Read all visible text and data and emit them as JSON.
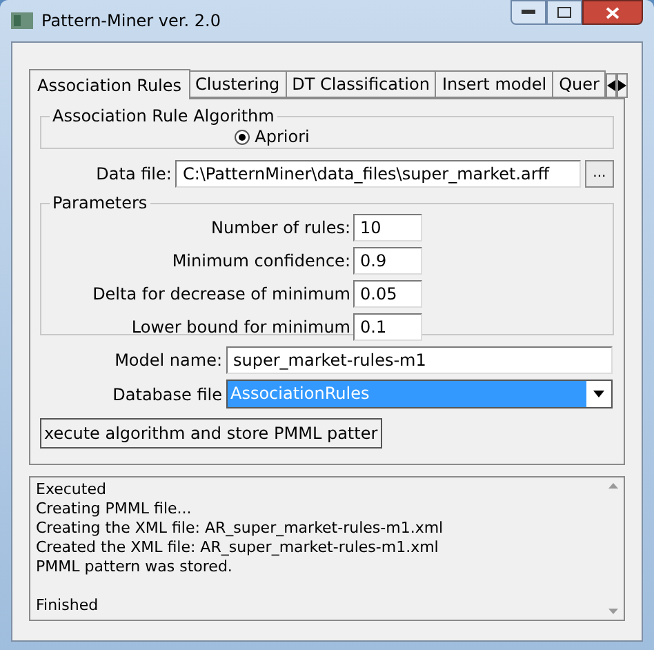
{
  "window": {
    "title": "Pattern-Miner ver. 2.0"
  },
  "tabs": [
    {
      "label": "Association Rules",
      "selected": true
    },
    {
      "label": "Clustering",
      "selected": false
    },
    {
      "label": "DT Classification",
      "selected": false
    },
    {
      "label": "Insert model",
      "selected": false
    },
    {
      "label": "Quer",
      "selected": false
    }
  ],
  "algorithm_group": {
    "title": "Association Rule Algorithm",
    "options": [
      {
        "label": "Apriori",
        "selected": true
      }
    ]
  },
  "data_file": {
    "label": "Data file:",
    "value": "C:\\PatternMiner\\data_files\\super_market.arff",
    "browse": "..."
  },
  "parameters": {
    "title": "Parameters",
    "fields": [
      {
        "label": "Number of rules:",
        "value": "10"
      },
      {
        "label": "Minimum confidence:",
        "value": "0.9"
      },
      {
        "label": "Delta for decrease of minimum",
        "value": "0.05"
      },
      {
        "label": "Lower bound for minimum",
        "value": "0.1"
      }
    ]
  },
  "model_name": {
    "label": "Model name:",
    "value": "super_market-rules-m1"
  },
  "database_file": {
    "label": "Database file",
    "value": "AssociationRules"
  },
  "execute_button": "xecute algorithm and store PMML patter",
  "log": [
    [
      "Executed",
      "Creating PMML file...",
      "Creating the XML file: AR_super_market-rules-m1.xml",
      "Created the XML file: AR_super_market-rules-m1.xml",
      "PMML pattern was stored."
    ],
    [
      "Finished"
    ]
  ]
}
